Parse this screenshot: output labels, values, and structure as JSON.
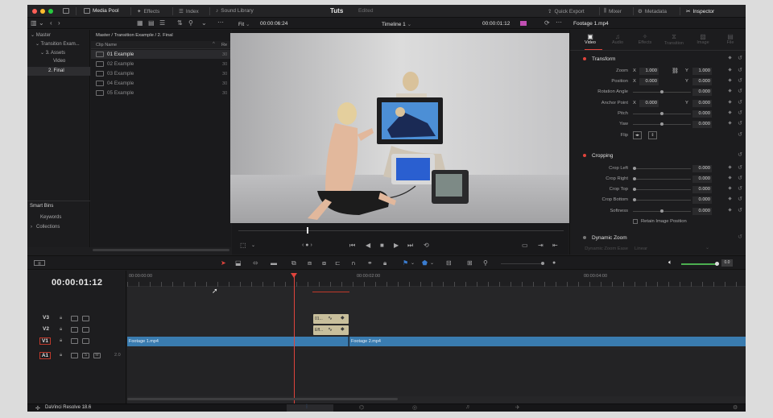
{
  "topbar": {
    "media_pool": "Media Pool",
    "effects": "Effects",
    "index": "Index",
    "sound_library": "Sound Library",
    "project_title": "Tuts",
    "project_status": "Edited",
    "quick_export": "Quick Export",
    "mixer": "Mixer",
    "metadata": "Metadata",
    "inspector": "Inspector"
  },
  "viewer_bar": {
    "zoom": "Fit",
    "source_timecode": "00:00:06:24",
    "timeline_name": "Timeline 1",
    "record_timecode": "00:00:01:12"
  },
  "bins": {
    "items": [
      "Master",
      "Transition Exam...",
      "3. Assets",
      "Video",
      "2. Final"
    ],
    "smart_bins_label": "Smart Bins",
    "smart_items": [
      "Keywords",
      "Collections"
    ]
  },
  "media_pool_panel": {
    "breadcrumb": "Master / Transition Example / 2. Final",
    "column_header": "Clip Name",
    "column_header_2": "Re",
    "clips": [
      {
        "name": "01 Example",
        "rate": "30"
      },
      {
        "name": "02 Example",
        "rate": "30"
      },
      {
        "name": "03 Example",
        "rate": "30"
      },
      {
        "name": "04 Example",
        "rate": "30"
      },
      {
        "name": "05 Example",
        "rate": "30"
      }
    ]
  },
  "inspector": {
    "clip_title": "Footage 1.mp4",
    "tabs": [
      "Video",
      "Audio",
      "Effects",
      "Transition",
      "Image",
      "File"
    ],
    "transform_title": "Transform",
    "zoom_label": "Zoom",
    "zoom_x": "1.000",
    "zoom_y": "1.000",
    "position_label": "Position",
    "position_x": "0.000",
    "position_y": "0.000",
    "rotation_label": "Rotation Angle",
    "rotation_val": "0.000",
    "anchor_label": "Anchor Point",
    "anchor_x": "0.000",
    "anchor_y": "0.000",
    "pitch_label": "Pitch",
    "pitch_val": "0.000",
    "yaw_label": "Yaw",
    "yaw_val": "0.000",
    "flip_label": "Flip",
    "cropping_title": "Cropping",
    "crop_left_label": "Crop Left",
    "crop_left_val": "0.000",
    "crop_right_label": "Crop Right",
    "crop_right_val": "0.000",
    "crop_top_label": "Crop Top",
    "crop_top_val": "0.000",
    "crop_bottom_label": "Crop Bottom",
    "crop_bottom_val": "0.000",
    "softness_label": "Softness",
    "softness_val": "0.000",
    "retain_label": "Retain Image Position",
    "dynamic_zoom_title": "Dynamic Zoom",
    "dynamic_zoom_ease_label": "Dynamic Zoom Ease",
    "dynamic_zoom_ease_val": "Linear",
    "axis_x": "X",
    "axis_y": "Y"
  },
  "timeline": {
    "current_timecode": "00:00:01:12",
    "ruler_labels": [
      "00:00:00:00",
      "00:00:02:00",
      "00:00:04:00"
    ],
    "tracks": [
      "V3",
      "V2",
      "V1",
      "A1"
    ],
    "audio_level": "2.0",
    "clip_v1_a": "Footage 1.mp4",
    "clip_v1_b": "Footage 2.mp4",
    "clip_v3": "01...",
    "clip_v2": "Eff...",
    "volume_level": "0.0"
  },
  "bottombar": {
    "app_name": "DaVinci Resolve 18.6"
  },
  "colors": {
    "accent_red": "#e0443c",
    "clip_blue": "#3a7cb0",
    "playhead": "#e0443c",
    "volume_green": "#4caf50"
  }
}
